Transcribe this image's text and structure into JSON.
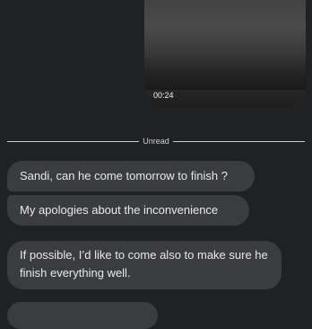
{
  "video": {
    "duration": "00:24"
  },
  "divider": {
    "label": "Unread"
  },
  "messages": [
    "Sandi, can he come tomorrow to finish ?",
    "My apologies about the inconvenience",
    "If possible, I’d like to come also to make sure he finish everything well.",
    ""
  ]
}
